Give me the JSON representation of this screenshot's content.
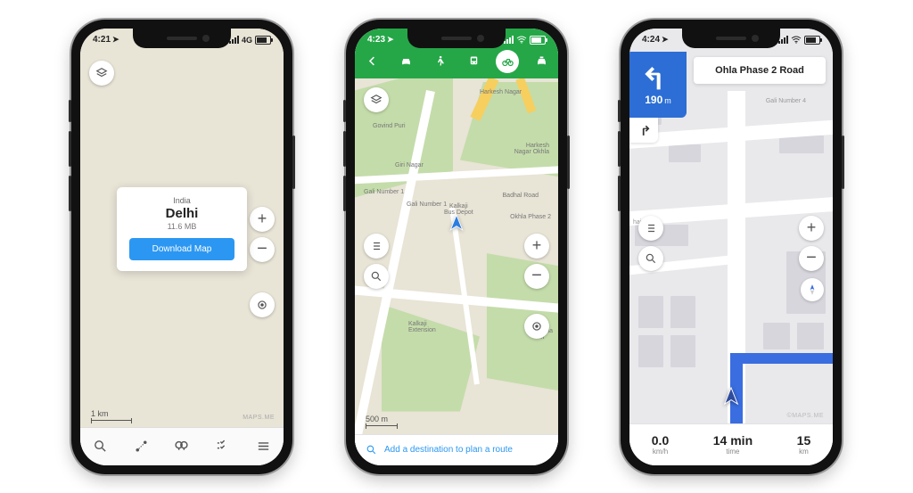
{
  "phone1": {
    "time": "4:21",
    "network": "4G",
    "card": {
      "country": "India",
      "city": "Delhi",
      "size": "11.6 MB",
      "button": "Download Map"
    },
    "scale": "1 km",
    "attribution": "MAPS.ME"
  },
  "phone2": {
    "time": "4:23",
    "modes": [
      "back",
      "car",
      "walk",
      "transit",
      "bike",
      "taxi"
    ],
    "selected_mode": "bike",
    "labels": {
      "harkesh": "Harkesh Nagar",
      "govind": "Govind Puri",
      "giri": "Giri Nagar",
      "gali1a": "Gali Number 1",
      "gali1b": "Gali Number 1",
      "kalkaji_depot": "Kalkaji\nBus Depot",
      "harkesh_okhla": "Harkesh\nNagar Okhla",
      "badhal": "Badhal Road",
      "okhla_p2": "Okhla Phase 2",
      "kalkaji_ext": "Kalkaji\nExtension",
      "okhla": "Okhla\nPh"
    },
    "scale": "500 m",
    "bottom_prompt": "Add a destination to plan a route"
  },
  "phone3": {
    "time": "4:24",
    "turn": {
      "distance": "190",
      "unit": "m"
    },
    "road_name": "Ohla Phase 2 Road",
    "labels": {
      "gali4": "Gali Number 4",
      "marg": "hai Marg"
    },
    "stats": {
      "speed": {
        "value": "0.0",
        "unit": "km/h"
      },
      "eta": {
        "value": "14 min",
        "unit": "time"
      },
      "dist": {
        "value": "15",
        "unit": "km"
      }
    },
    "attribution": "©MAPS.ME"
  }
}
